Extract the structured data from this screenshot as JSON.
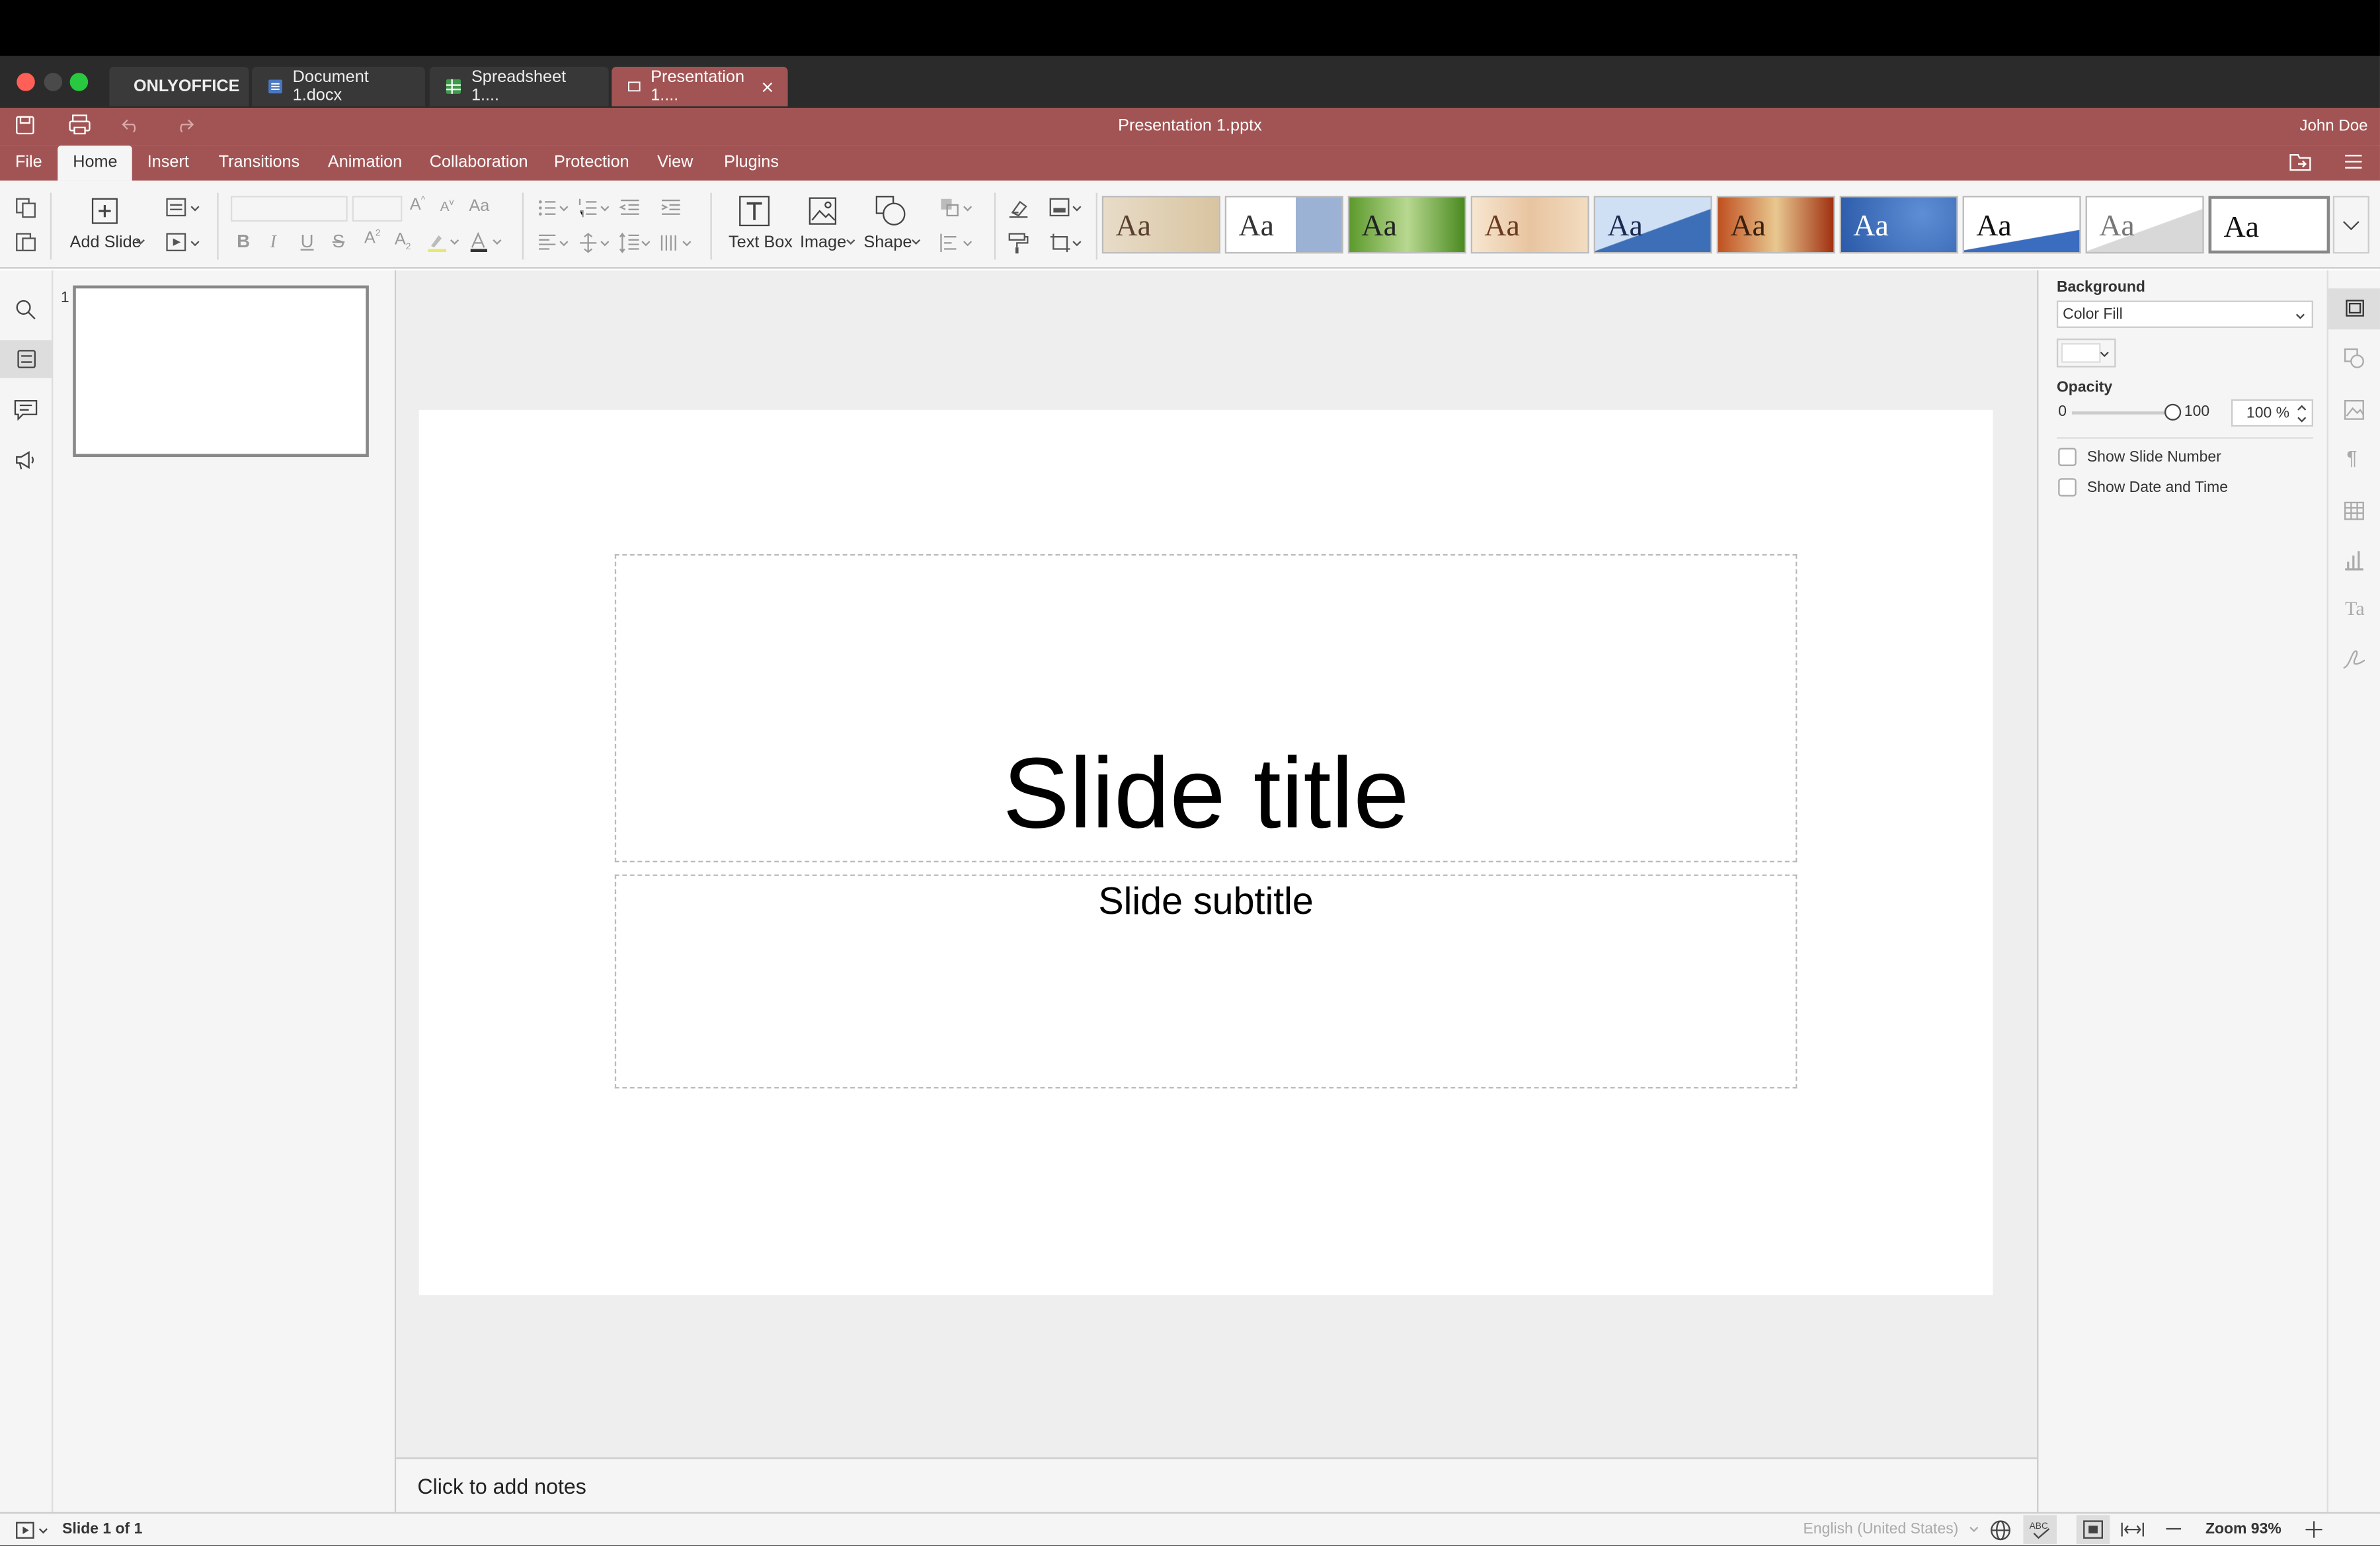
{
  "tabs": [
    {
      "label": "ONLYOFFICE",
      "icon": "onlyoffice-logo-icon"
    },
    {
      "label": "Document 1.docx",
      "icon": "document-icon"
    },
    {
      "label": "Spreadsheet 1....",
      "icon": "spreadsheet-icon"
    },
    {
      "label": "Presentation 1....",
      "icon": "presentation-icon",
      "active": true
    }
  ],
  "title": "Presentation 1.pptx",
  "user": "John Doe",
  "menu": [
    "File",
    "Home",
    "Insert",
    "Transitions",
    "Animation",
    "Collaboration",
    "Protection",
    "View",
    "Plugins"
  ],
  "toolbar": {
    "add_slide": "Add Slide",
    "text_box": "Text Box",
    "image": "Image",
    "shape": "Shape",
    "theme_sample": "Aa"
  },
  "colors": {
    "accent": "#a25454",
    "tabbar": "#2b2b2b",
    "toolbar": "#f5f5f5",
    "canvas_bg": "#eeeeee"
  },
  "thumbs": [
    {
      "number": "1"
    }
  ],
  "slide": {
    "title": "Slide title",
    "subtitle": "Slide subtitle"
  },
  "notes": "Click to add notes",
  "right_panel": {
    "background_label": "Background",
    "fill_value": "Color Fill",
    "opacity_label": "Opacity",
    "opacity_min": "0",
    "opacity_max": "100",
    "opacity_value": "100 %",
    "opacity_fraction": 1.0,
    "show_slide_number": "Show Slide Number",
    "show_date_time": "Show Date and Time"
  },
  "status": {
    "slide_counter": "Slide 1 of 1",
    "language": "English (United States)",
    "zoom": "Zoom 93%"
  }
}
